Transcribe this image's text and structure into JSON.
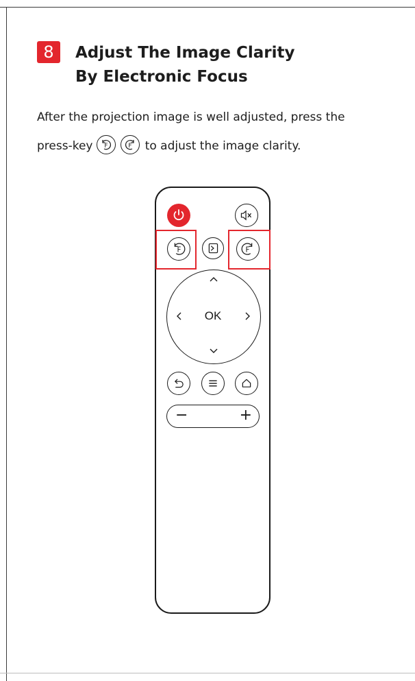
{
  "step": {
    "number": "8",
    "title_line1": "Adjust The Image Clarity",
    "title_line2": "By Electronic Focus"
  },
  "instruction": {
    "line1": "After the projection image is well adjusted, press the",
    "line2_prefix": "press-key",
    "line2_suffix": "to adjust the image clarity."
  },
  "remote": {
    "ok_label": "OK",
    "buttons": [
      "power-icon",
      "mute-icon",
      "focus-minus-icon",
      "input-source-icon",
      "focus-plus-icon",
      "back-icon",
      "menu-icon",
      "home-icon",
      "volume-minus",
      "volume-plus"
    ],
    "highlighted_buttons": [
      "focus-minus-icon",
      "focus-plus-icon"
    ]
  },
  "colors": {
    "accent": "#e3262d",
    "text": "#1d1d1d"
  }
}
